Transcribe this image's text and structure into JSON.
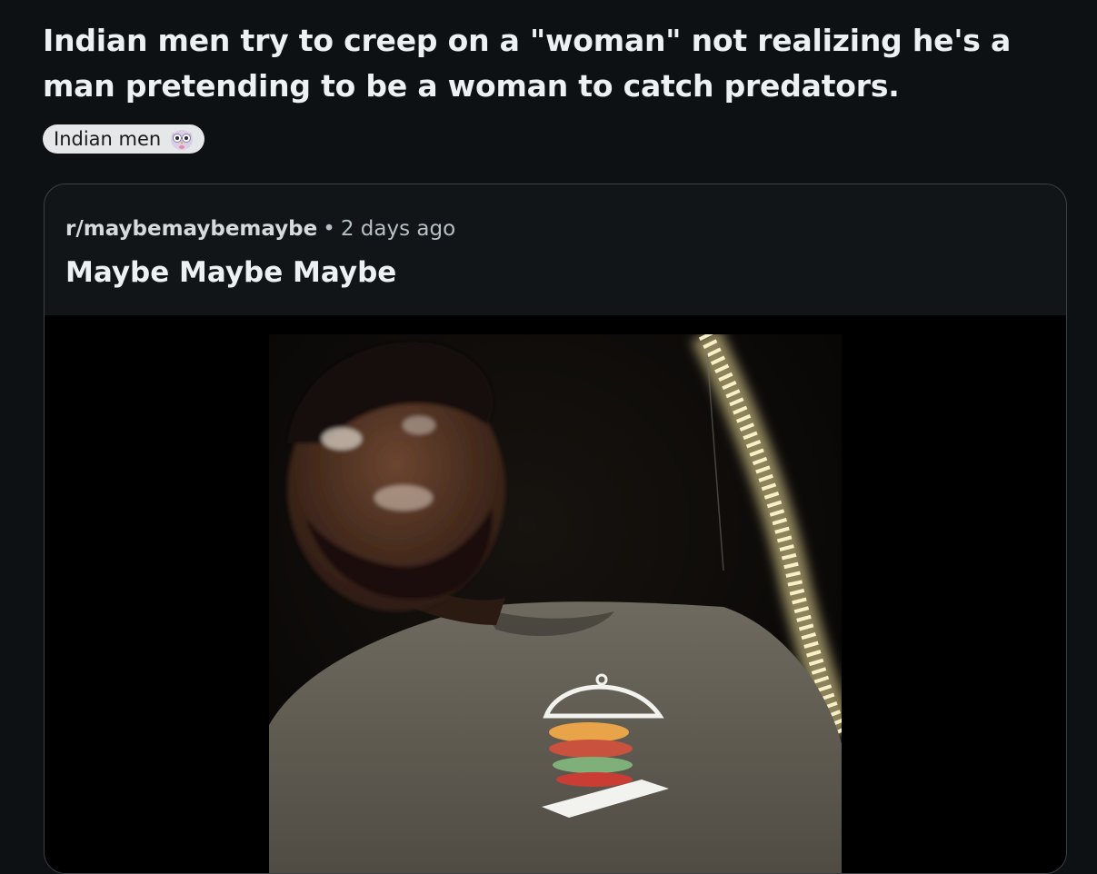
{
  "post": {
    "title": "Indian men try to creep on a \"woman\" not realizing he's a man pretending to be a woman to catch predators.",
    "flair": {
      "label": "Indian men",
      "emoji_icon": "shocked-owl-emoji-icon"
    }
  },
  "crosspost": {
    "subreddit": "r/maybemaybemaybe",
    "separator": "•",
    "time_ago": "2 days ago",
    "title": "Maybe Maybe Maybe",
    "media_type": "video"
  },
  "colors": {
    "background": "#0e1113",
    "card_border": "#3a4043",
    "flair_background": "#e5e7e9"
  }
}
